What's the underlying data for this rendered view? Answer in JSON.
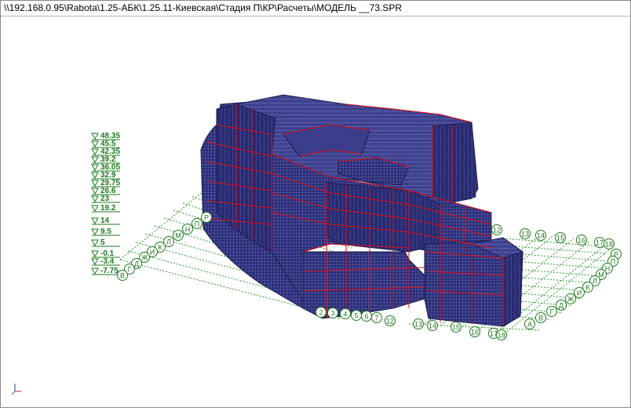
{
  "window": {
    "title": "\\\\192.168.0.95\\Rabota\\1.25-АБК\\1.25.11-Киевская\\Стадия П\\КР\\Расчеты\\МОДЕЛЬ __73.SPR"
  },
  "colors": {
    "mesh": "#2b2e78",
    "mesh_dark": "#1c1d52",
    "frame_lines": "#e0101a",
    "grid": "#2e9a2e",
    "labels": "#1e7a1e"
  },
  "level_marks": [
    "48.35",
    "45.5",
    "42.35",
    "39.2",
    "36.05",
    "32.9",
    "29.75",
    "26.6",
    "23",
    "19.2",
    "14",
    "9.5",
    "5",
    "-0.1",
    "-3.4",
    "-7.75"
  ],
  "axes": {
    "left_letters": [
      "Р",
      "П",
      "Н",
      "М",
      "Л",
      "К",
      "И",
      "Ж",
      "Д",
      "Г",
      "В"
    ],
    "right_letters": [
      "Р",
      "П",
      "Н",
      "М",
      "Л",
      "К",
      "И",
      "Ж",
      "Д",
      "Г",
      "В",
      "А"
    ],
    "front_numbers": [
      "2",
      "3",
      "4",
      "5",
      "6",
      "7",
      "12",
      "13",
      "14",
      "15",
      "16",
      "17",
      "18"
    ],
    "top_numbers": [
      "12",
      "13",
      "14",
      "15",
      "16",
      "17",
      "18"
    ]
  },
  "triad_icon": "xyz-axis-triad-icon"
}
